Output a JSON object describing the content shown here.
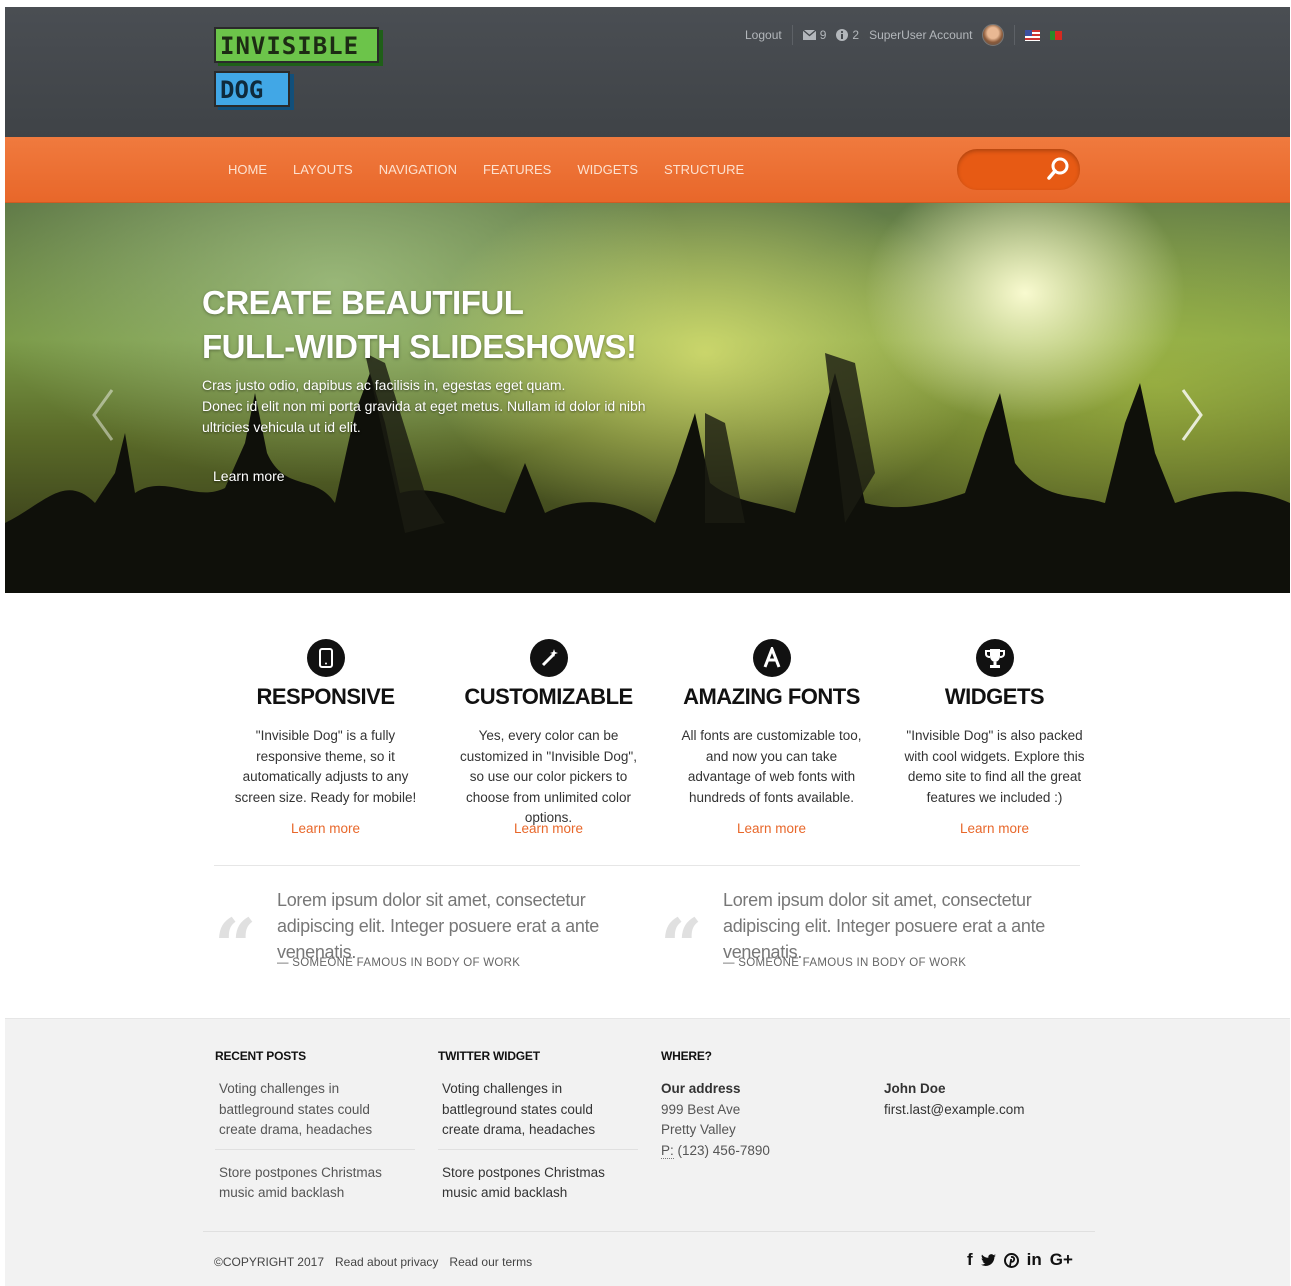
{
  "header": {
    "logo_line1": "INVISIBLE",
    "logo_line2": "DOG",
    "logout": "Logout",
    "messages_count": "9",
    "notifications_count": "2",
    "account": "SuperUser Account"
  },
  "nav": {
    "items": [
      "HOME",
      "LAYOUTS",
      "NAVIGATION",
      "FEATURES",
      "WIDGETS",
      "STRUCTURE"
    ]
  },
  "hero": {
    "title_line1": "CREATE BEAUTIFUL",
    "title_line2": "FULL-WIDTH SLIDESHOWS!",
    "text_line1": "Cras justo odio, dapibus ac facilisis in, egestas eget quam.",
    "text_line2": "Donec id elit non mi porta gravida at eget metus. Nullam id dolor id nibh",
    "text_line3": "ultricies vehicula ut id elit.",
    "link": "Learn more"
  },
  "features": [
    {
      "icon": "mobile-icon",
      "title": "RESPONSIVE",
      "text": "\"Invisible Dog\" is a fully responsive theme, so it automatically adjusts to any screen size. Ready for mobile!",
      "link": "Learn more"
    },
    {
      "icon": "magic-wand-icon",
      "title": "CUSTOMIZABLE",
      "text": "Yes, every color can be customized in \"Invisible Dog\", so use our color pickers to choose from unlimited color options.",
      "link": "Learn more"
    },
    {
      "icon": "font-icon",
      "title": "AMAZING FONTS",
      "text": "All fonts are customizable too, and now you can take advantage of web fonts with hundreds of fonts available.",
      "link": "Learn more"
    },
    {
      "icon": "trophy-icon",
      "title": "WIDGETS",
      "text": "\"Invisible Dog\" is also packed with cool widgets. Explore this demo site to find all the great features we included :)",
      "link": "Learn more"
    }
  ],
  "quotes": [
    {
      "text": "Lorem ipsum dolor sit amet, consectetur adipiscing elit. Integer posuere erat a ante venenatis.",
      "by": "— SOMEONE FAMOUS IN BODY OF WORK"
    },
    {
      "text": "Lorem ipsum dolor sit amet, consectetur adipiscing elit. Integer posuere erat a ante venenatis.",
      "by": "— SOMEONE FAMOUS IN BODY OF WORK"
    }
  ],
  "footer": {
    "recent_title": "RECENT POSTS",
    "recent_posts": [
      "Voting challenges in battleground states could create drama, headaches",
      "Store postpones Christmas music amid backlash"
    ],
    "twitter_title": "TWITTER WIDGET",
    "twitter_posts": [
      "Voting challenges in battleground states could create drama, headaches",
      "Store postpones Christmas music amid backlash"
    ],
    "where_title": "WHERE?",
    "address_label": "Our address",
    "address_line1": "999 Best Ave",
    "address_line2": "Pretty Valley",
    "phone_label": "P:",
    "phone": "(123) 456-7890",
    "contact_name": "John Doe",
    "contact_email": "first.last@example.com",
    "copyright": "©COPYRIGHT 2017",
    "privacy": "Read about privacy",
    "terms": "Read our terms",
    "social": [
      "f",
      "in",
      "G+"
    ]
  },
  "colors": {
    "header_bg": "#44484c",
    "accent_orange": "#e8672a",
    "logo_green": "#6cc44a",
    "logo_blue": "#41a7e6"
  }
}
